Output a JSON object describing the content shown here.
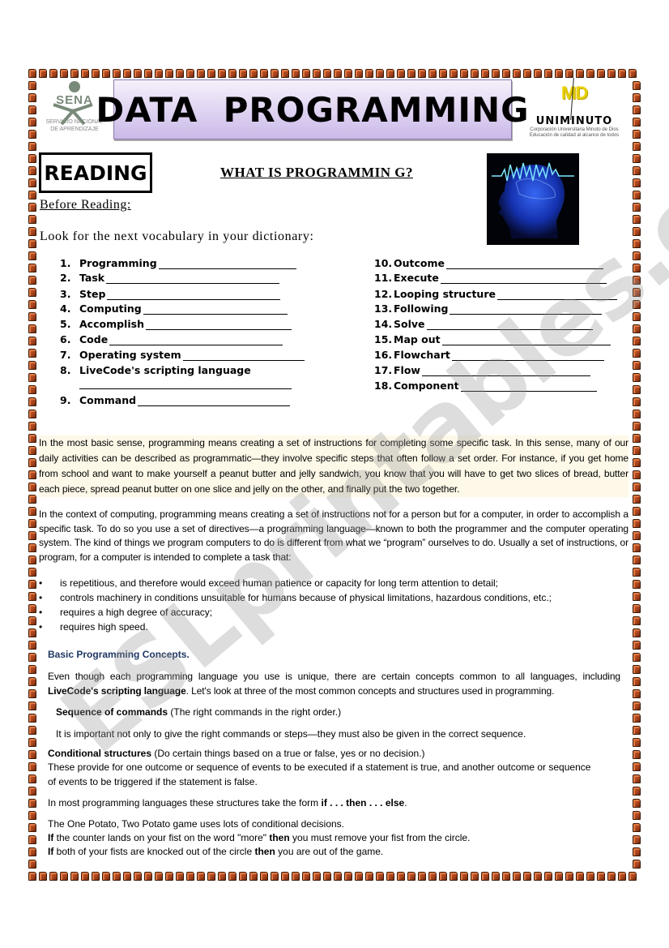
{
  "header": {
    "left_logo": {
      "name": "SENA",
      "subtitle_line1": "SERVICIO NACIONAL",
      "subtitle_line2": "DE APRENDIZAJE"
    },
    "title": "DATA  PROGRAMMING",
    "right_logo": {
      "mark": "MD",
      "name": "UNIMINUTO",
      "line1": "Corporación Universitaria Minuto de Dios",
      "line2": "Educación de calidad al alcance de todos"
    }
  },
  "section_label": "READING",
  "section_title": "WHAT IS PROGRAMMIN G?",
  "image": {
    "description": "brain-head-illustration"
  },
  "before_reading": "Before Reading:",
  "instruction": "Look for the next vocabulary in your dictionary:",
  "vocabulary_left": [
    {
      "num": "1.",
      "word": "Programming"
    },
    {
      "num": "2.",
      "word": "Task"
    },
    {
      "num": "3.",
      "word": "Step"
    },
    {
      "num": "4.",
      "word": "Computing"
    },
    {
      "num": "5.",
      "word": "Accomplish"
    },
    {
      "num": "6.",
      "word": "Code"
    },
    {
      "num": "7.",
      "word": "Operating system"
    },
    {
      "num": "8.",
      "word": "LiveCode's scripting language"
    },
    {
      "num": "9.",
      "word": "Command"
    }
  ],
  "vocabulary_right": [
    {
      "num": "10.",
      "word": "Outcome"
    },
    {
      "num": "11.",
      "word": "Execute"
    },
    {
      "num": "12.",
      "word": "Looping structure"
    },
    {
      "num": "13.",
      "word": "Following"
    },
    {
      "num": "14.",
      "word": "Solve"
    },
    {
      "num": "15.",
      "word": "Map out"
    },
    {
      "num": "16.",
      "word": "Flowchart"
    },
    {
      "num": "17.",
      "word": "Flow"
    },
    {
      "num": "18.",
      "word": "Component"
    }
  ],
  "paragraph1": "In the most basic sense, programming means creating a set of instructions for completing some specific task. In this sense, many of our daily activities can be described as programmatic—they involve specific steps that often follow a set order. For instance, if you get home from school and want to make yourself a peanut butter and jelly sandwich, you know that you will have to get two slices of bread, butter each piece, spread peanut butter on one slice and jelly on the other, and finally put the two together.",
  "paragraph2": "In the context of computing, programming means creating a set of instructions not for a person but for a computer, in order to accomplish a specific task. To do so you use a set of directives—a programming language—known to both the programmer and the computer operating system. The kind of things we program computers to do is different from what we “program” ourselves to do. Usually a set of instructions, or program, for a computer is intended to complete a task that:",
  "bullets": [
    "is repetitious, and therefore would exceed human patience or capacity for long term attention to detail;",
    "controls machinery in conditions unsuitable for humans because of physical limitations, hazardous conditions, etc.;",
    "requires a high degree of accuracy;",
    "requires high speed."
  ],
  "concepts_heading": "Basic Programming Concepts.",
  "concepts_intro_1": "Even though each programming language you use is unique, there are certain concepts common to all languages, including",
  "concepts_intro_bold": "LiveCode's scripting language",
  "concepts_intro_2": ". Let's look at three of the most common concepts and structures used in programming.",
  "sequence_bold": "Sequence of commands",
  "sequence_rest": " (The right commands in the right order.)",
  "sequence_text": "It is important not only to give the right commands or steps—they must also be given in the correct sequence.",
  "conditional_bold": "Conditional structures",
  "conditional_rest": " (Do certain things based on a true or false, yes or no decision.)",
  "conditional_text1": "These provide for one outcome or sequence of events to be executed if a statement is true, and another outcome or sequence",
  "conditional_text2": "of events to be triggered if the statement is false.",
  "form_text": "In most programming languages these structures take the form ",
  "form_bold": "if . . . then . . . else",
  "form_end": ".",
  "potato_line": "The One Potato, Two Potato game uses lots of conditional decisions.",
  "rule1": {
    "if": "If",
    "a": " the counter lands on your fist on the word \"more\" ",
    "then": "then",
    "b": " you must remove your fist from the circle."
  },
  "rule2": {
    "if": "If",
    "a": " both of your fists are knocked out of the circle ",
    "then": "then",
    "b": " you are out of the game."
  },
  "watermark": "ESLprintables.com",
  "colors": {
    "brick": "#a9431c",
    "title_box": "#cab9e8",
    "heading_blue": "#1f3864",
    "highlight": "#fdf8e8"
  }
}
